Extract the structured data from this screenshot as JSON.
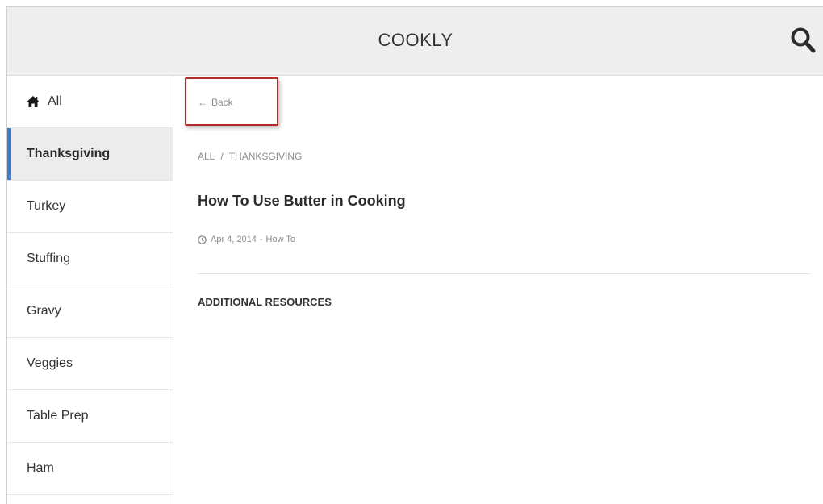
{
  "header": {
    "title": "COOKLY",
    "search_icon": "search-icon"
  },
  "sidebar": {
    "items": [
      {
        "label": "All",
        "icon": "home-icon",
        "active": false
      },
      {
        "label": "Thanksgiving",
        "active": true
      },
      {
        "label": "Turkey",
        "active": false
      },
      {
        "label": "Stuffing",
        "active": false
      },
      {
        "label": "Gravy",
        "active": false
      },
      {
        "label": "Veggies",
        "active": false
      },
      {
        "label": "Table Prep",
        "active": false
      },
      {
        "label": "Ham",
        "active": false
      }
    ]
  },
  "main": {
    "back_arrow": "←",
    "back_label": "Back",
    "breadcrumb": {
      "root": "ALL",
      "separator": "/",
      "current": "THANKSGIVING"
    },
    "article": {
      "title": "How To Use Butter in Cooking",
      "date": "Apr 4, 2014",
      "meta_separator": "-",
      "category": "How To"
    },
    "section_heading": "ADDITIONAL RESOURCES"
  },
  "colors": {
    "header_bg": "#eeeeee",
    "active_accent": "#3a7bd5",
    "highlight_box": "#b22a2a",
    "muted_text": "#8a8a8a"
  }
}
